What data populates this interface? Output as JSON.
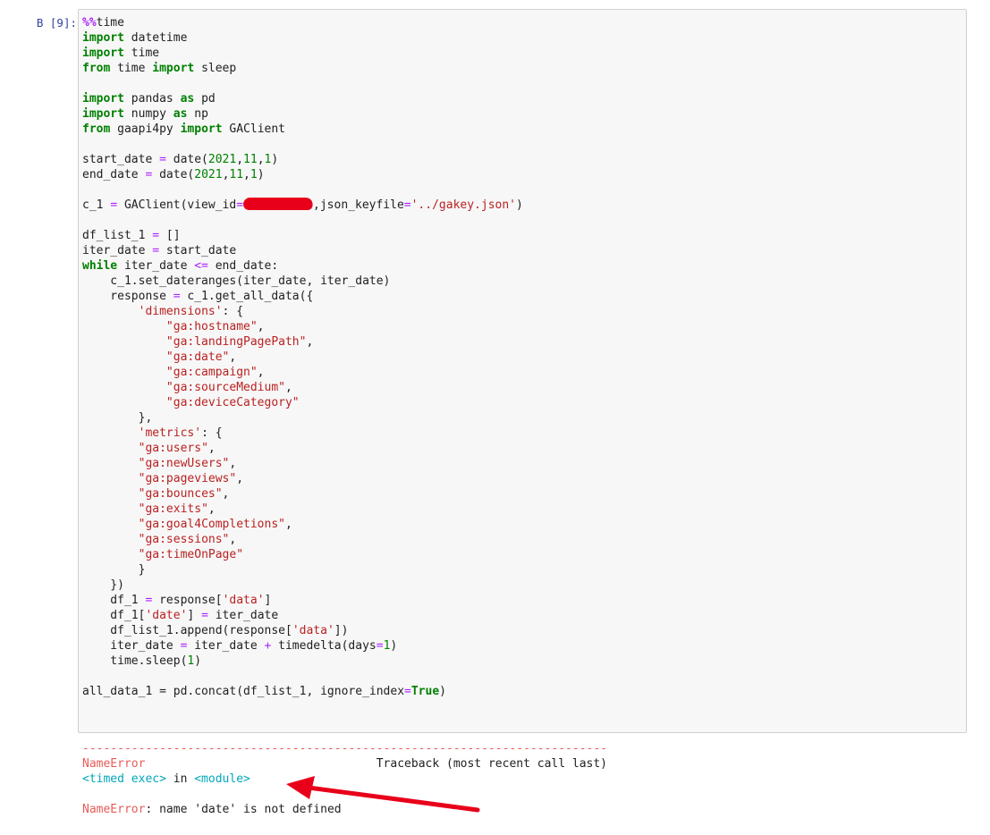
{
  "prompt": "В [9]:",
  "code": {
    "lines": [
      [
        {
          "t": "%%",
          "c": "mg"
        },
        {
          "t": "time"
        }
      ],
      [
        {
          "t": "import",
          "c": "kw"
        },
        {
          "t": " datetime"
        }
      ],
      [
        {
          "t": "import",
          "c": "kw"
        },
        {
          "t": " time"
        }
      ],
      [
        {
          "t": "from",
          "c": "kw"
        },
        {
          "t": " time "
        },
        {
          "t": "import",
          "c": "kw"
        },
        {
          "t": " sleep"
        }
      ],
      [],
      [
        {
          "t": "import",
          "c": "kw"
        },
        {
          "t": " pandas "
        },
        {
          "t": "as",
          "c": "kw"
        },
        {
          "t": " pd"
        }
      ],
      [
        {
          "t": "import",
          "c": "kw"
        },
        {
          "t": " numpy "
        },
        {
          "t": "as",
          "c": "kw"
        },
        {
          "t": " np"
        }
      ],
      [
        {
          "t": "from",
          "c": "kw"
        },
        {
          "t": " gaapi4py "
        },
        {
          "t": "import",
          "c": "kw"
        },
        {
          "t": " GAClient"
        }
      ],
      [],
      [
        {
          "t": "start_date "
        },
        {
          "t": "=",
          "c": "op"
        },
        {
          "t": " date("
        },
        {
          "t": "2021",
          "c": "nm"
        },
        {
          "t": ","
        },
        {
          "t": "11",
          "c": "nm"
        },
        {
          "t": ","
        },
        {
          "t": "1",
          "c": "nm"
        },
        {
          "t": ")"
        }
      ],
      [
        {
          "t": "end_date "
        },
        {
          "t": "=",
          "c": "op"
        },
        {
          "t": " date("
        },
        {
          "t": "2021",
          "c": "nm"
        },
        {
          "t": ","
        },
        {
          "t": "11",
          "c": "nm"
        },
        {
          "t": ","
        },
        {
          "t": "1",
          "c": "nm"
        },
        {
          "t": ")"
        }
      ],
      [],
      [
        {
          "t": "c_1 "
        },
        {
          "t": "=",
          "c": "op"
        },
        {
          "t": " GAClient(view_id"
        },
        {
          "t": "=",
          "c": "op"
        },
        {
          "redact": true
        },
        {
          "t": ",json_keyfile"
        },
        {
          "t": "=",
          "c": "op"
        },
        {
          "t": "'../gakey.json'",
          "c": "st"
        },
        {
          "t": ")"
        }
      ],
      [],
      [
        {
          "t": "df_list_1 "
        },
        {
          "t": "=",
          "c": "op"
        },
        {
          "t": " []"
        }
      ],
      [
        {
          "t": "iter_date "
        },
        {
          "t": "=",
          "c": "op"
        },
        {
          "t": " start_date"
        }
      ],
      [
        {
          "t": "while",
          "c": "kw"
        },
        {
          "t": " iter_date "
        },
        {
          "t": "<=",
          "c": "op"
        },
        {
          "t": " end_date:"
        }
      ],
      [
        {
          "t": "    c_1.set_dateranges(iter_date, iter_date)"
        }
      ],
      [
        {
          "t": "    response "
        },
        {
          "t": "=",
          "c": "op"
        },
        {
          "t": " c_1.get_all_data({"
        }
      ],
      [
        {
          "t": "        "
        },
        {
          "t": "'dimensions'",
          "c": "st"
        },
        {
          "t": ": {"
        }
      ],
      [
        {
          "t": "            "
        },
        {
          "t": "\"ga:hostname\"",
          "c": "st"
        },
        {
          "t": ","
        }
      ],
      [
        {
          "t": "            "
        },
        {
          "t": "\"ga:landingPagePath\"",
          "c": "st"
        },
        {
          "t": ","
        }
      ],
      [
        {
          "t": "            "
        },
        {
          "t": "\"ga:date\"",
          "c": "st"
        },
        {
          "t": ","
        }
      ],
      [
        {
          "t": "            "
        },
        {
          "t": "\"ga:campaign\"",
          "c": "st"
        },
        {
          "t": ","
        }
      ],
      [
        {
          "t": "            "
        },
        {
          "t": "\"ga:sourceMedium\"",
          "c": "st"
        },
        {
          "t": ","
        }
      ],
      [
        {
          "t": "            "
        },
        {
          "t": "\"ga:deviceCategory\"",
          "c": "st"
        }
      ],
      [
        {
          "t": "        },"
        }
      ],
      [
        {
          "t": "        "
        },
        {
          "t": "'metrics'",
          "c": "st"
        },
        {
          "t": ": {"
        }
      ],
      [
        {
          "t": "        "
        },
        {
          "t": "\"ga:users\"",
          "c": "st"
        },
        {
          "t": ","
        }
      ],
      [
        {
          "t": "        "
        },
        {
          "t": "\"ga:newUsers\"",
          "c": "st"
        },
        {
          "t": ","
        }
      ],
      [
        {
          "t": "        "
        },
        {
          "t": "\"ga:pageviews\"",
          "c": "st"
        },
        {
          "t": ","
        }
      ],
      [
        {
          "t": "        "
        },
        {
          "t": "\"ga:bounces\"",
          "c": "st"
        },
        {
          "t": ","
        }
      ],
      [
        {
          "t": "        "
        },
        {
          "t": "\"ga:exits\"",
          "c": "st"
        },
        {
          "t": ","
        }
      ],
      [
        {
          "t": "        "
        },
        {
          "t": "\"ga:goal4Completions\"",
          "c": "st"
        },
        {
          "t": ","
        }
      ],
      [
        {
          "t": "        "
        },
        {
          "t": "\"ga:sessions\"",
          "c": "st"
        },
        {
          "t": ","
        }
      ],
      [
        {
          "t": "        "
        },
        {
          "t": "\"ga:timeOnPage\"",
          "c": "st"
        }
      ],
      [
        {
          "t": "        }"
        }
      ],
      [
        {
          "t": "    })"
        }
      ],
      [
        {
          "t": "    df_1 "
        },
        {
          "t": "=",
          "c": "op"
        },
        {
          "t": " response["
        },
        {
          "t": "'data'",
          "c": "st"
        },
        {
          "t": "]"
        }
      ],
      [
        {
          "t": "    df_1["
        },
        {
          "t": "'date'",
          "c": "st"
        },
        {
          "t": "] "
        },
        {
          "t": "=",
          "c": "op"
        },
        {
          "t": " iter_date"
        }
      ],
      [
        {
          "t": "    df_list_1.append(response["
        },
        {
          "t": "'data'",
          "c": "st"
        },
        {
          "t": "])"
        }
      ],
      [
        {
          "t": "    iter_date "
        },
        {
          "t": "=",
          "c": "op"
        },
        {
          "t": " iter_date "
        },
        {
          "t": "+",
          "c": "op"
        },
        {
          "t": " timedelta(days"
        },
        {
          "t": "=",
          "c": "op"
        },
        {
          "t": "1",
          "c": "nm"
        },
        {
          "t": ")"
        }
      ],
      [
        {
          "t": "    time.sleep("
        },
        {
          "t": "1",
          "c": "nm"
        },
        {
          "t": ")"
        }
      ],
      [],
      [
        {
          "t": "all_data_1 "
        },
        {
          "t": "="
        },
        {
          "t": " pd.concat(df_list_1, ignore_index"
        },
        {
          "t": "=",
          "c": "op"
        },
        {
          "t": "True",
          "c": "kw"
        },
        {
          "t": ")"
        }
      ]
    ]
  },
  "output": {
    "lines": [
      [
        {
          "t": "---------------------------------------------------------------------------",
          "c": "err"
        }
      ],
      [
        {
          "t": "NameError",
          "c": "err"
        },
        {
          "t": "                                 Traceback (most recent call last)"
        }
      ],
      [
        {
          "t": "<timed exec>",
          "c": "cy"
        },
        {
          "t": " in "
        },
        {
          "t": "<module>",
          "c": "cy"
        }
      ],
      [],
      [
        {
          "t": "NameError",
          "c": "err"
        },
        {
          "t": ": name 'date' is not defined"
        }
      ]
    ]
  },
  "colors": {
    "arrow": "#e8001a",
    "redaction": "#e8001a"
  }
}
